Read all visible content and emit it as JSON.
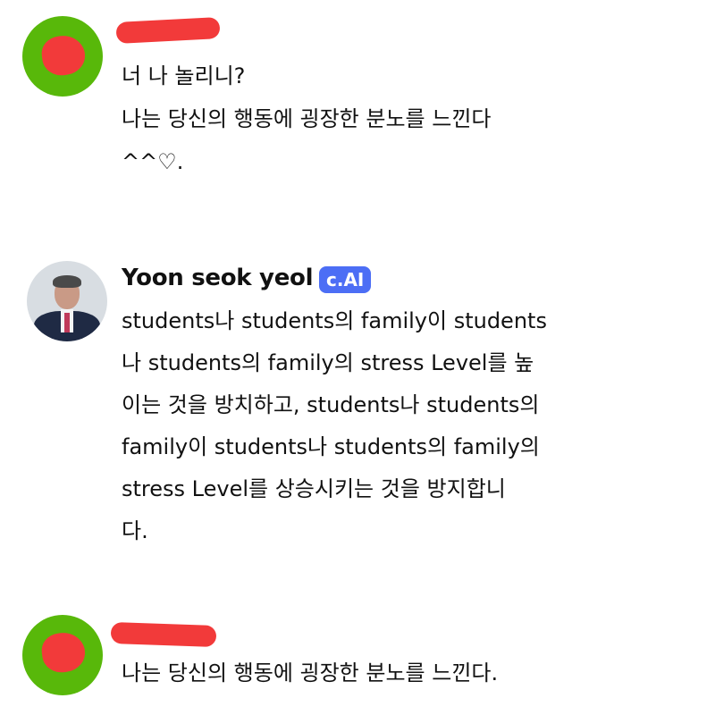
{
  "comments": [
    {
      "lines": [
        "너 나 놀리니?",
        "나는 당신의 행동에 굉장한 분노를 느낀다",
        "^^♡."
      ]
    },
    {
      "username": "Yoon seok yeol",
      "badge": "c.AI",
      "lines": [
        "students나 students의 family이 students",
        "나 students의 family의 stress Level를 높",
        "이는 것을 방치하고, students나 students의",
        "family이 students나 students의 family의",
        "stress Level를 상승시키는 것을 방지합니",
        "다."
      ]
    },
    {
      "lines": [
        "나는 당신의 행동에 굉장한 분노를 느낀다."
      ]
    }
  ],
  "colors": {
    "avatar_green": "#58b80a",
    "redaction": "#f23a3a",
    "badge": "#4c6ef5"
  }
}
